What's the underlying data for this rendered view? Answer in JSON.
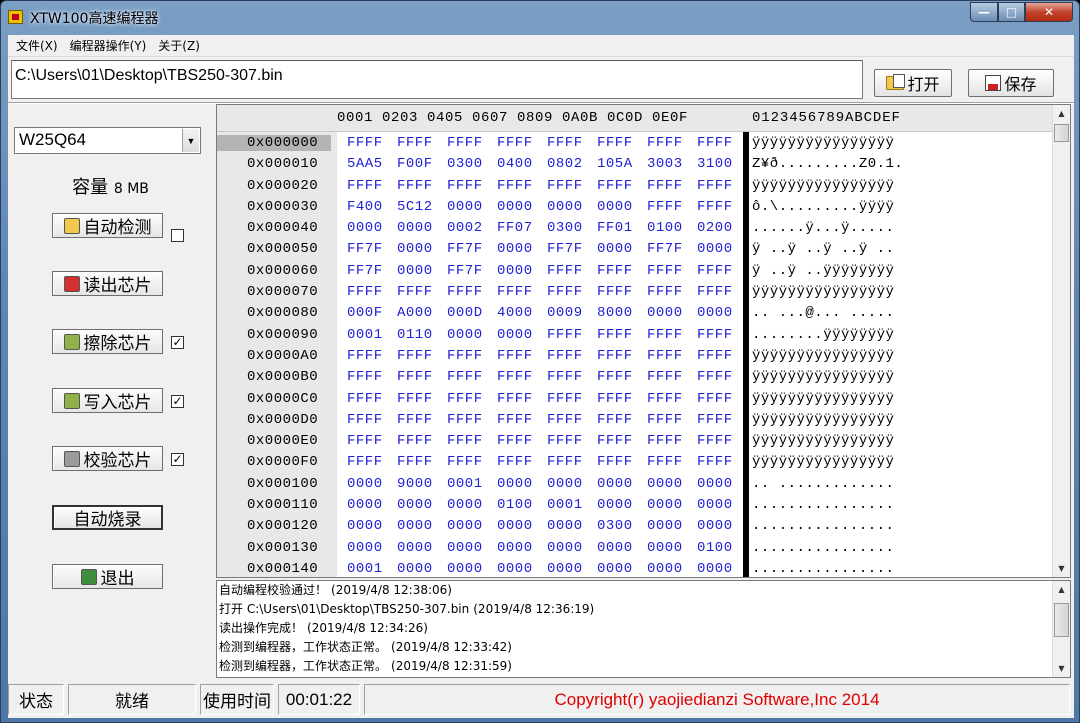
{
  "window": {
    "title": "XTW100高速编程器"
  },
  "menu": [
    "文件(X)",
    "编程器操作(Y)",
    "关于(Z)"
  ],
  "path": {
    "value": "C:\\Users\\01\\Desktop\\TBS250-307.bin"
  },
  "toolbar": {
    "open_label": "打开",
    "save_label": "保存"
  },
  "left": {
    "chip": "W25Q64",
    "capacity_label": "容量",
    "capacity_value": "8 MB",
    "buttons": [
      {
        "label": "自动检测",
        "icon": "detect-icon",
        "checkbox": false
      },
      {
        "label": "读出芯片",
        "icon": "read-icon"
      },
      {
        "label": "擦除芯片",
        "icon": "erase-icon",
        "checkbox": true
      },
      {
        "label": "写入芯片",
        "icon": "write-icon",
        "checkbox": true
      },
      {
        "label": "校验芯片",
        "icon": "verify-icon",
        "checkbox": true
      }
    ],
    "auto_burn": "自动烧录",
    "exit": "退出"
  },
  "hex": {
    "header_cols": "0001 0203 0405 0607 0809 0A0B 0C0D 0E0F",
    "header_ascii": "0123456789ABCDEF",
    "rows": [
      {
        "addr": "0x000000",
        "cells": [
          "FFFF",
          "FFFF",
          "FFFF",
          "FFFF",
          "FFFF",
          "FFFF",
          "FFFF",
          "FFFF"
        ],
        "ascii": "ÿÿÿÿÿÿÿÿÿÿÿÿÿÿÿÿ"
      },
      {
        "addr": "0x000010",
        "cells": [
          "5AA5",
          "F00F",
          "0300",
          "0400",
          "0802",
          "105A",
          "3003",
          "3100"
        ],
        "ascii": "Z¥ð.........Z0.1."
      },
      {
        "addr": "0x000020",
        "cells": [
          "FFFF",
          "FFFF",
          "FFFF",
          "FFFF",
          "FFFF",
          "FFFF",
          "FFFF",
          "FFFF"
        ],
        "ascii": "ÿÿÿÿÿÿÿÿÿÿÿÿÿÿÿÿ"
      },
      {
        "addr": "0x000030",
        "cells": [
          "F400",
          "5C12",
          "0000",
          "0000",
          "0000",
          "0000",
          "FFFF",
          "FFFF"
        ],
        "ascii": "ô.\\.........ÿÿÿÿ"
      },
      {
        "addr": "0x000040",
        "cells": [
          "0000",
          "0000",
          "0002",
          "FF07",
          "0300",
          "FF01",
          "0100",
          "0200"
        ],
        "ascii": "......ÿ...ÿ....."
      },
      {
        "addr": "0x000050",
        "cells": [
          "FF7F",
          "0000",
          "FF7F",
          "0000",
          "FF7F",
          "0000",
          "FF7F",
          "0000"
        ],
        "ascii": "ÿ ..ÿ ..ÿ ..ÿ .."
      },
      {
        "addr": "0x000060",
        "cells": [
          "FF7F",
          "0000",
          "FF7F",
          "0000",
          "FFFF",
          "FFFF",
          "FFFF",
          "FFFF"
        ],
        "ascii": "ÿ ..ÿ ..ÿÿÿÿÿÿÿÿ"
      },
      {
        "addr": "0x000070",
        "cells": [
          "FFFF",
          "FFFF",
          "FFFF",
          "FFFF",
          "FFFF",
          "FFFF",
          "FFFF",
          "FFFF"
        ],
        "ascii": "ÿÿÿÿÿÿÿÿÿÿÿÿÿÿÿÿ"
      },
      {
        "addr": "0x000080",
        "cells": [
          "000F",
          "A000",
          "000D",
          "4000",
          "0009",
          "8000",
          "0000",
          "0000"
        ],
        "ascii": ".. ...@... ....."
      },
      {
        "addr": "0x000090",
        "cells": [
          "0001",
          "0110",
          "0000",
          "0000",
          "FFFF",
          "FFFF",
          "FFFF",
          "FFFF"
        ],
        "ascii": "........ÿÿÿÿÿÿÿÿ"
      },
      {
        "addr": "0x0000A0",
        "cells": [
          "FFFF",
          "FFFF",
          "FFFF",
          "FFFF",
          "FFFF",
          "FFFF",
          "FFFF",
          "FFFF"
        ],
        "ascii": "ÿÿÿÿÿÿÿÿÿÿÿÿÿÿÿÿ"
      },
      {
        "addr": "0x0000B0",
        "cells": [
          "FFFF",
          "FFFF",
          "FFFF",
          "FFFF",
          "FFFF",
          "FFFF",
          "FFFF",
          "FFFF"
        ],
        "ascii": "ÿÿÿÿÿÿÿÿÿÿÿÿÿÿÿÿ"
      },
      {
        "addr": "0x0000C0",
        "cells": [
          "FFFF",
          "FFFF",
          "FFFF",
          "FFFF",
          "FFFF",
          "FFFF",
          "FFFF",
          "FFFF"
        ],
        "ascii": "ÿÿÿÿÿÿÿÿÿÿÿÿÿÿÿÿ"
      },
      {
        "addr": "0x0000D0",
        "cells": [
          "FFFF",
          "FFFF",
          "FFFF",
          "FFFF",
          "FFFF",
          "FFFF",
          "FFFF",
          "FFFF"
        ],
        "ascii": "ÿÿÿÿÿÿÿÿÿÿÿÿÿÿÿÿ"
      },
      {
        "addr": "0x0000E0",
        "cells": [
          "FFFF",
          "FFFF",
          "FFFF",
          "FFFF",
          "FFFF",
          "FFFF",
          "FFFF",
          "FFFF"
        ],
        "ascii": "ÿÿÿÿÿÿÿÿÿÿÿÿÿÿÿÿ"
      },
      {
        "addr": "0x0000F0",
        "cells": [
          "FFFF",
          "FFFF",
          "FFFF",
          "FFFF",
          "FFFF",
          "FFFF",
          "FFFF",
          "FFFF"
        ],
        "ascii": "ÿÿÿÿÿÿÿÿÿÿÿÿÿÿÿÿ"
      },
      {
        "addr": "0x000100",
        "cells": [
          "0000",
          "9000",
          "0001",
          "0000",
          "0000",
          "0000",
          "0000",
          "0000"
        ],
        "ascii": ".. ............."
      },
      {
        "addr": "0x000110",
        "cells": [
          "0000",
          "0000",
          "0000",
          "0100",
          "0001",
          "0000",
          "0000",
          "0000"
        ],
        "ascii": "................"
      },
      {
        "addr": "0x000120",
        "cells": [
          "0000",
          "0000",
          "0000",
          "0000",
          "0000",
          "0300",
          "0000",
          "0000"
        ],
        "ascii": "................"
      },
      {
        "addr": "0x000130",
        "cells": [
          "0000",
          "0000",
          "0000",
          "0000",
          "0000",
          "0000",
          "0000",
          "0100"
        ],
        "ascii": "................"
      },
      {
        "addr": "0x000140",
        "cells": [
          "0001",
          "0000",
          "0000",
          "0000",
          "0000",
          "0000",
          "0000",
          "0000"
        ],
        "ascii": "................"
      }
    ]
  },
  "log": [
    {
      "msg": "自动编程校验通过！",
      "time": "(2019/4/8 12:38:06)"
    },
    {
      "msg": "打开 C:\\Users\\01\\Desktop\\TBS250-307.bin",
      "time": "(2019/4/8 12:36:19)"
    },
    {
      "msg": "读出操作完成！",
      "time": "(2019/4/8 12:34:26)"
    },
    {
      "msg": "检测到编程器，工作状态正常。",
      "time": "(2019/4/8 12:33:42)"
    },
    {
      "msg": "检测到编程器，工作状态正常。",
      "time": "(2019/4/8 12:31:59)"
    }
  ],
  "status": {
    "state_label": "状态",
    "state_value": "就绪",
    "time_label": "使用时间",
    "time_value": "00:01:22",
    "copyright": "Copyright(r) yaojiedianzi Software,Inc 2014"
  }
}
